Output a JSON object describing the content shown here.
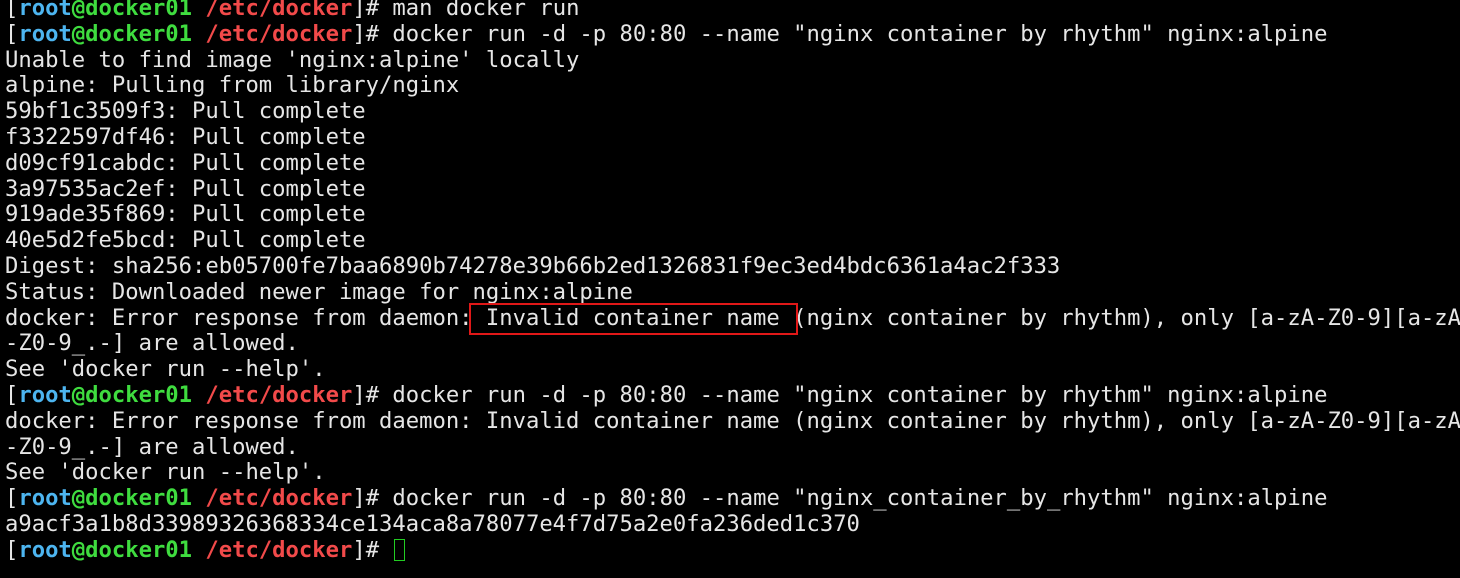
{
  "prompt": {
    "user": "root",
    "at": "@",
    "host": "docker01",
    "path": "/etc/docker",
    "open": "[",
    "close": "]# "
  },
  "colors": {
    "user": "#4db5f0",
    "host": "#3fdc3f",
    "path": "#f24a4a",
    "text": "#e6e6e6",
    "highlight": "#e01818",
    "cursor": "#22cc22"
  },
  "lines": [
    {
      "prompt": true,
      "text": "man docker run"
    },
    {
      "prompt": true,
      "text": "docker run -d -p 80:80 --name \"nginx container by rhythm\" nginx:alpine"
    },
    {
      "text": "Unable to find image 'nginx:alpine' locally"
    },
    {
      "text": "alpine: Pulling from library/nginx"
    },
    {
      "text": "59bf1c3509f3: Pull complete"
    },
    {
      "text": "f3322597df46: Pull complete"
    },
    {
      "text": "d09cf91cabdc: Pull complete"
    },
    {
      "text": "3a97535ac2ef: Pull complete"
    },
    {
      "text": "919ade35f869: Pull complete"
    },
    {
      "text": "40e5d2fe5bcd: Pull complete"
    },
    {
      "text": "Digest: sha256:eb05700fe7baa6890b74278e39b66b2ed1326831f9ec3ed4bdc6361a4ac2f333"
    },
    {
      "text": "Status: Downloaded newer image for nginx:alpine"
    },
    {
      "text": "docker: Error response from daemon: Invalid container name (nginx container by rhythm), only [a-zA-Z0-9][a-zA"
    },
    {
      "text": "-Z0-9_.-] are allowed."
    },
    {
      "text": "See 'docker run --help'."
    },
    {
      "prompt": true,
      "text": "docker run -d -p 80:80 --name \"nginx container by rhythm\" nginx:alpine"
    },
    {
      "text": "docker: Error response from daemon: Invalid container name (nginx container by rhythm), only [a-zA-Z0-9][a-zA"
    },
    {
      "text": "-Z0-9_.-] are allowed."
    },
    {
      "text": "See 'docker run --help'."
    },
    {
      "prompt": true,
      "text": "docker run -d -p 80:80 --name \"nginx_container_by_rhythm\" nginx:alpine"
    },
    {
      "text": "a9acf3a1b8d33989326368334ce134aca8a78077e4f7d75a2e0fa236ded1c370"
    },
    {
      "prompt": true,
      "text": "",
      "cursor": true
    }
  ]
}
